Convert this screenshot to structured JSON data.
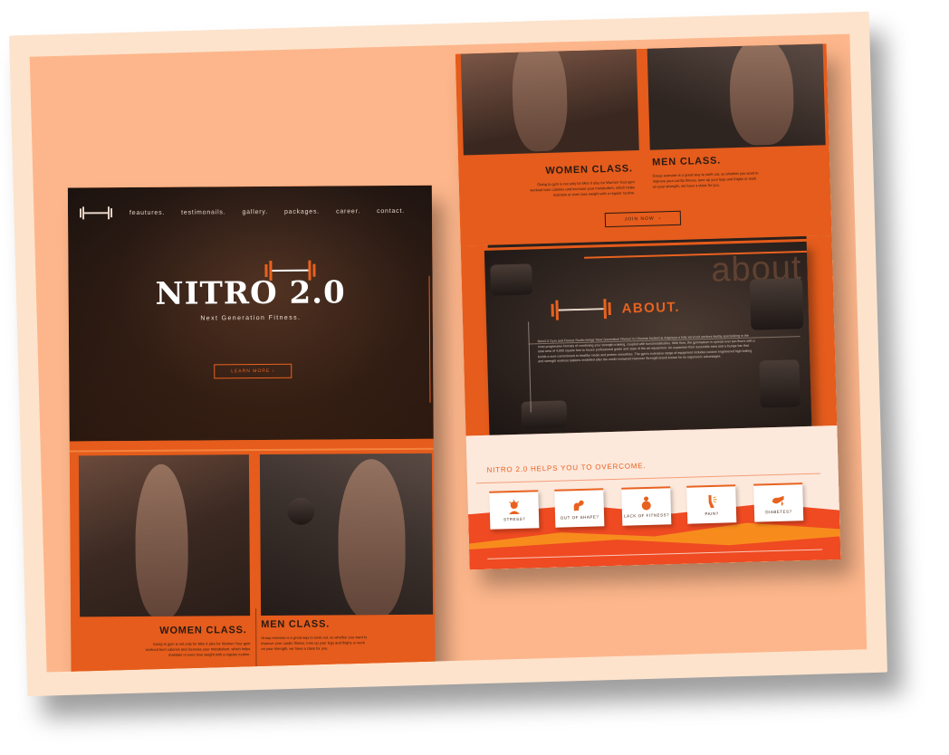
{
  "nav": {
    "links": [
      "feautures.",
      "testimonails.",
      "gallery.",
      "packages.",
      "career.",
      "contact."
    ]
  },
  "hero": {
    "title": "NITRO 2.0",
    "subtitle": "Next Generation Fitness.",
    "cta": "LEARN MORE"
  },
  "classes": {
    "women_title": "WOMEN CLASS.",
    "women_text": "Going to gym is not only for Men it also for Women Your gym workout burn calories and increase your metabolism, which helps maintain or even lose weight with a regular routine.",
    "men_title": "MEN CLASS.",
    "men_text": "Group exercise is a great way to work out, so whether you want to improve your cardio fitness, tone up your legs and thighs or work on your strength, we have a class for you.",
    "join": "JOIN NOW"
  },
  "about": {
    "ghost_text": "about",
    "title": "ABOUT.",
    "text": "Nitro2.0 Gym and Fitness Studio brings 'Next Generation Fitness' to Chennai located at Anjaneya a fully serviced workout facility specializing in the most progressive formats of combining your strength training, coupled with functionalstudies. With floor, the gymnasium is spread over two floors with a total area of 4,000 square feet to house professional grade and state of the art equipment. An expansive floor assemble area and a lounge bar that builds a sure commitment to healthy meals and protein smoothies. The gym's extensive range of equipment includes custom engineered high bolting and strength workout stations modelled after the world renowned Hammer Strength brand known for its ergonomic advantages."
  },
  "overcome": {
    "title": "NITRO 2.0 HELPS YOU TO OVERCOME.",
    "cards": [
      {
        "label": "STRESS?",
        "icon": "stress-icon"
      },
      {
        "label": "OUT OF SHAPE?",
        "icon": "flex-arm-icon"
      },
      {
        "label": "LACK OF FITNESS?",
        "icon": "body-icon"
      },
      {
        "label": "PAIN?",
        "icon": "pain-icon"
      },
      {
        "label": "DIABETES?",
        "icon": "blood-drop-icon"
      }
    ]
  },
  "colors": {
    "accent": "#e8621f",
    "board": "#fdb68b",
    "frame": "#fde3cc"
  }
}
